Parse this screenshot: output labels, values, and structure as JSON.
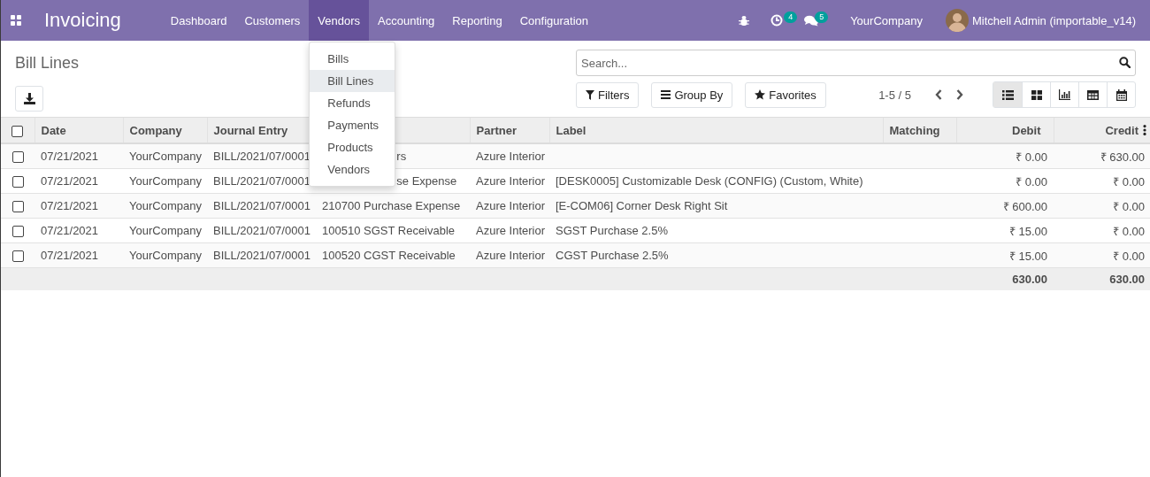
{
  "navbar": {
    "app_title": "Invoicing",
    "menus": [
      {
        "label": "Dashboard",
        "selected": false
      },
      {
        "label": "Customers",
        "selected": false
      },
      {
        "label": "Vendors",
        "selected": true
      },
      {
        "label": "Accounting",
        "selected": false
      },
      {
        "label": "Reporting",
        "selected": false
      },
      {
        "label": "Configuration",
        "selected": false
      }
    ],
    "activity_count": "4",
    "message_count": "5",
    "company": "YourCompany",
    "user": "Mitchell Admin (importable_v14)"
  },
  "dropdown": {
    "items": [
      {
        "label": "Bills",
        "selected": false
      },
      {
        "label": "Bill Lines",
        "selected": true
      },
      {
        "label": "Refunds",
        "selected": false
      },
      {
        "label": "Payments",
        "selected": false
      },
      {
        "label": "Products",
        "selected": false
      },
      {
        "label": "Vendors",
        "selected": false
      }
    ]
  },
  "control_panel": {
    "title": "Bill Lines",
    "search": {
      "placeholder": "Search..."
    },
    "buttons": [
      {
        "kind": "filter",
        "label": "Filters"
      },
      {
        "kind": "group",
        "label": "Group By"
      },
      {
        "kind": "favorite",
        "label": "Favorites"
      }
    ],
    "pager": "1-5 / 5",
    "views": [
      {
        "kind": "list",
        "selected": true
      },
      {
        "kind": "kanban",
        "selected": false
      },
      {
        "kind": "graph",
        "selected": false
      },
      {
        "kind": "pivot",
        "selected": false
      },
      {
        "kind": "calendar",
        "selected": false
      }
    ]
  },
  "table": {
    "select_all_checked": false,
    "columns": [
      {
        "kind": "text",
        "label": "Date"
      },
      {
        "kind": "text",
        "label": "Company"
      },
      {
        "kind": "text",
        "label": "Journal Entry"
      },
      {
        "kind": "text"
      },
      {
        "kind": "text",
        "label": "Partner"
      },
      {
        "kind": "text",
        "label": "Label"
      },
      {
        "kind": "text",
        "label": "Matching"
      },
      {
        "kind": "amount",
        "label": "Debit"
      },
      {
        "kind": "amount",
        "label": "Credit"
      }
    ],
    "rows": [
      {
        "checked": false,
        "cells": [
          "07/21/2021",
          "YourCompany",
          "BILL/2021/07/0001",
          "rs",
          "Azure Interior",
          null,
          null,
          "₹ 0.00",
          "₹ 630.00"
        ]
      },
      {
        "checked": false,
        "cells": [
          "07/21/2021",
          "YourCompany",
          "BILL/2021/07/0001",
          "se Expense",
          "Azure Interior",
          "[DESK0005] Customizable Desk (CONFIG) (Custom, White)",
          null,
          "₹ 0.00",
          "₹ 0.00"
        ]
      },
      {
        "checked": false,
        "cells": [
          "07/21/2021",
          "YourCompany",
          "BILL/2021/07/0001",
          "210700 Purchase Expense",
          "Azure Interior",
          "[E-COM06] Corner Desk Right Sit",
          null,
          "₹ 600.00",
          "₹ 0.00"
        ]
      },
      {
        "checked": false,
        "cells": [
          "07/21/2021",
          "YourCompany",
          "BILL/2021/07/0001",
          "100510 SGST Receivable",
          "Azure Interior",
          "SGST Purchase 2.5%",
          null,
          "₹ 15.00",
          "₹ 0.00"
        ]
      },
      {
        "checked": false,
        "cells": [
          "07/21/2021",
          "YourCompany",
          "BILL/2021/07/0001",
          "100520 CGST Receivable",
          "Azure Interior",
          "CGST Purchase 2.5%",
          null,
          "₹ 15.00",
          "₹ 0.00"
        ]
      }
    ],
    "totals": {
      "debit": "630.00",
      "credit": "630.00"
    }
  }
}
